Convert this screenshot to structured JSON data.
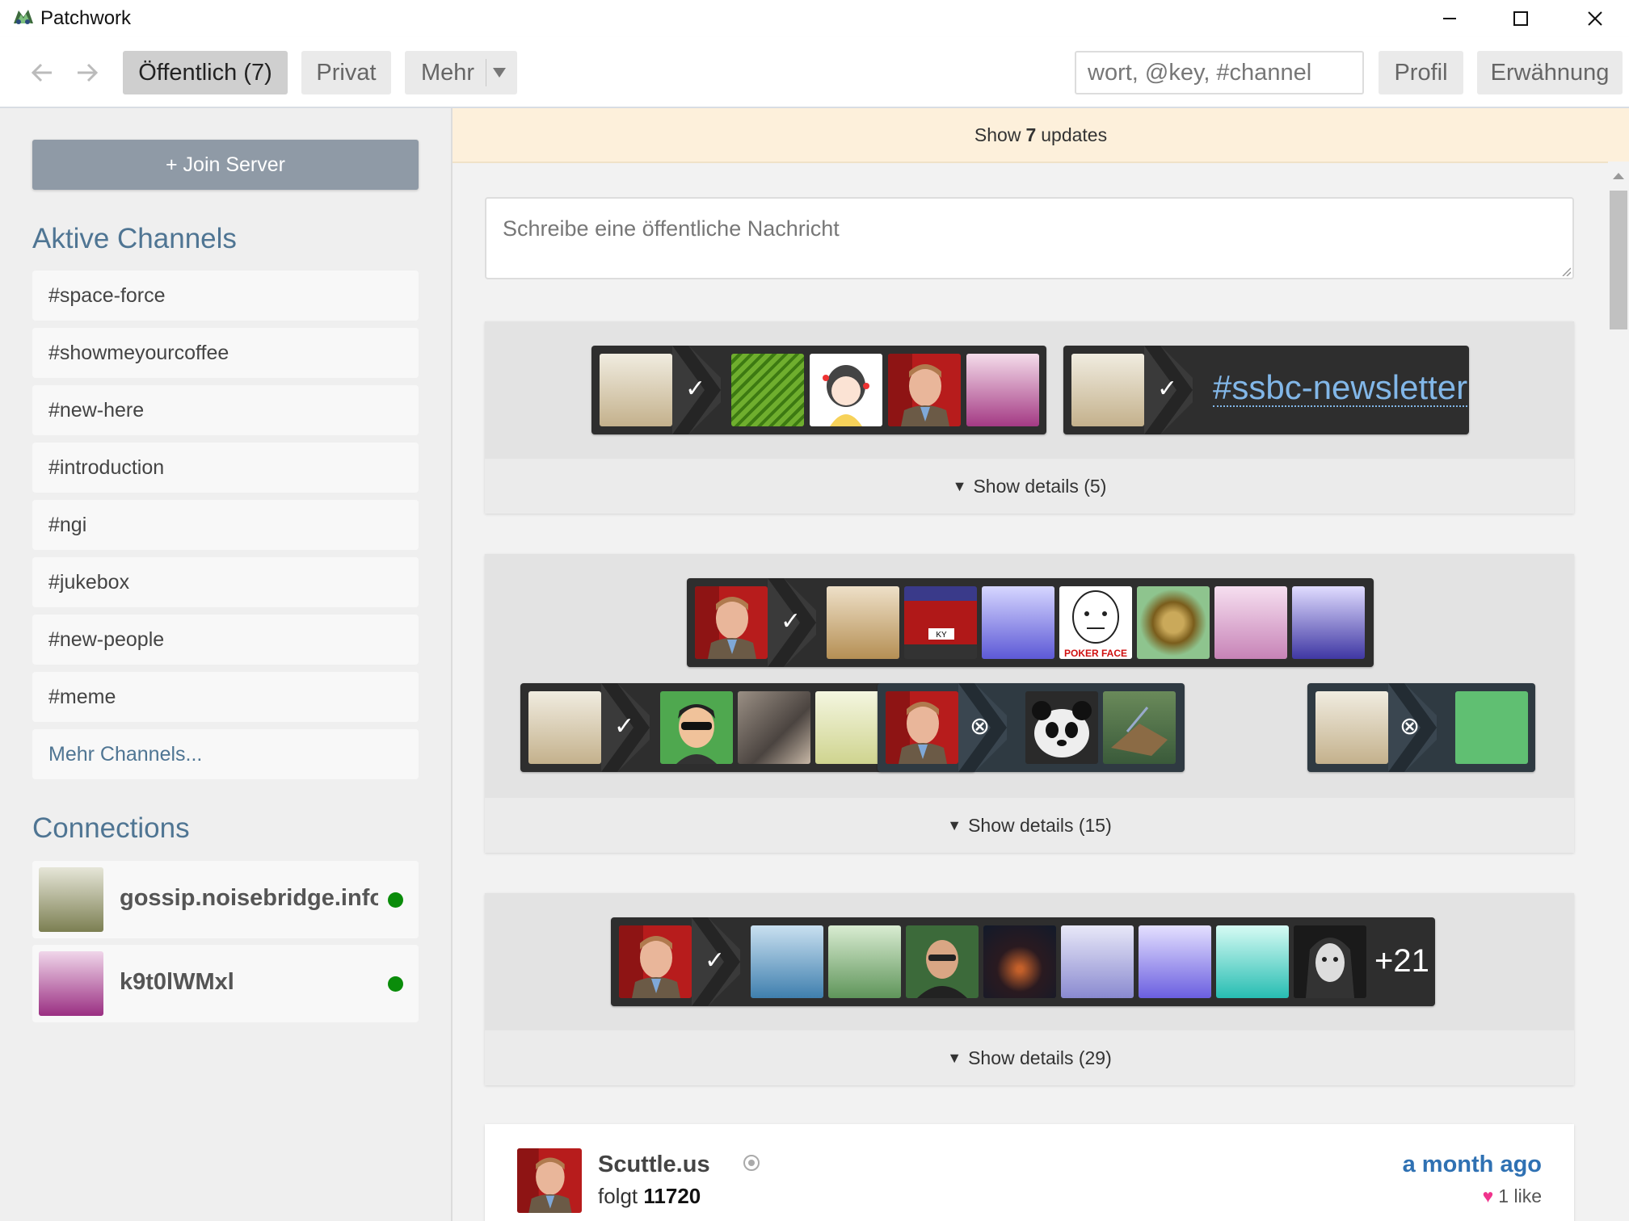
{
  "window": {
    "title": "Patchwork",
    "controls": [
      "minimize",
      "maximize",
      "close"
    ]
  },
  "nav": {
    "back_icon": "arrow-left-icon",
    "forward_icon": "arrow-right-icon",
    "tabs": [
      {
        "label": "Öffentlich (7)",
        "selected": true
      },
      {
        "label": "Privat",
        "selected": false
      },
      {
        "label": "Mehr",
        "selected": false
      }
    ],
    "search_placeholder": "wort, @key, #channel",
    "profile_label": "Profil",
    "mentions_label": "Erwähnung"
  },
  "sidebar": {
    "join_button": "+ Join Server",
    "channels_heading": "Aktive Channels",
    "channels": [
      "#space-force",
      "#showmeyourcoffee",
      "#new-here",
      "#introduction",
      "#ngi",
      "#jukebox",
      "#new-people",
      "#meme"
    ],
    "more_channels": "Mehr Channels...",
    "connections_heading": "Connections",
    "connections": [
      {
        "name": "gossip.noisebridge.info",
        "online": true
      },
      {
        "name": "k9t0lWMxl",
        "online": true
      }
    ]
  },
  "main": {
    "updates": {
      "prefix": "Show",
      "count": "7",
      "suffix": "updates"
    },
    "compose_placeholder": "Schreibe eine öffentliche Nachricht",
    "cards": [
      {
        "details": "Show details (5)",
        "channel_tag": "#ssbc-newsletter",
        "check_symbol": "✓"
      },
      {
        "details": "Show details (15)",
        "check_symbol": "✓",
        "block_symbol": "⊗"
      },
      {
        "details": "Show details (29)",
        "check_symbol": "✓",
        "more_count": "+21"
      }
    ],
    "post": {
      "author": "Scuttle.us",
      "follows_prefix": "folgt",
      "follows_count": "11720",
      "time": "a month ago",
      "likes": "1 like"
    }
  },
  "colors": {
    "accent_blue": "#4f7593",
    "link_blue": "#2f71b3",
    "online_green": "#0a8c0a",
    "updates_bar": "#fdf0db",
    "heart_pink": "#f0348c"
  }
}
